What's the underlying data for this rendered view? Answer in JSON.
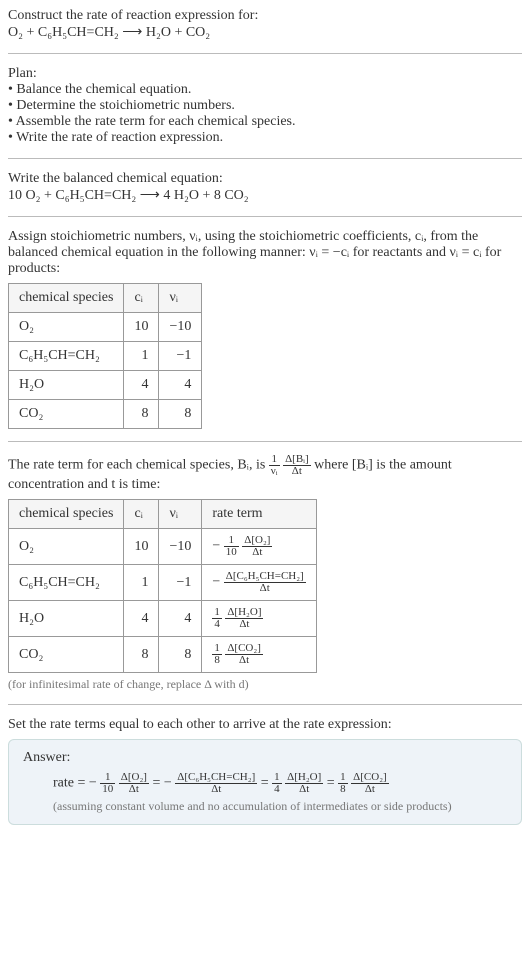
{
  "header": {
    "prompt": "Construct the rate of reaction expression for:",
    "equation": "O₂ + C₆H₅CH=CH₂ ⟶ H₂O + CO₂"
  },
  "plan": {
    "title": "Plan:",
    "items": [
      "• Balance the chemical equation.",
      "• Determine the stoichiometric numbers.",
      "• Assemble the rate term for each chemical species.",
      "• Write the rate of reaction expression."
    ]
  },
  "balanced": {
    "title": "Write the balanced chemical equation:",
    "equation": "10 O₂ + C₆H₅CH=CH₂ ⟶ 4 H₂O + 8 CO₂"
  },
  "stoich": {
    "intro": "Assign stoichiometric numbers, νᵢ, using the stoichiometric coefficients, cᵢ, from the balanced chemical equation in the following manner: νᵢ = −cᵢ for reactants and νᵢ = cᵢ for products:",
    "headers": [
      "chemical species",
      "cᵢ",
      "νᵢ"
    ],
    "rows": [
      {
        "species": "O₂",
        "c": "10",
        "v": "−10"
      },
      {
        "species": "C₆H₅CH=CH₂",
        "c": "1",
        "v": "−1"
      },
      {
        "species": "H₂O",
        "c": "4",
        "v": "4"
      },
      {
        "species": "CO₂",
        "c": "8",
        "v": "8"
      }
    ]
  },
  "rateterm": {
    "intro_pre": "The rate term for each chemical species, Bᵢ, is ",
    "frac1_num": "1",
    "frac1_den": "νᵢ",
    "frac2_num": "Δ[Bᵢ]",
    "frac2_den": "Δt",
    "intro_post": " where [Bᵢ] is the amount concentration and t is time:",
    "headers": [
      "chemical species",
      "cᵢ",
      "νᵢ",
      "rate term"
    ],
    "rows": [
      {
        "species": "O₂",
        "c": "10",
        "v": "−10",
        "sign": "−",
        "coef_num": "1",
        "coef_den": "10",
        "d_num": "Δ[O₂]",
        "d_den": "Δt"
      },
      {
        "species": "C₆H₅CH=CH₂",
        "c": "1",
        "v": "−1",
        "sign": "−",
        "coef_num": "",
        "coef_den": "",
        "d_num": "Δ[C₆H₅CH=CH₂]",
        "d_den": "Δt"
      },
      {
        "species": "H₂O",
        "c": "4",
        "v": "4",
        "sign": "",
        "coef_num": "1",
        "coef_den": "4",
        "d_num": "Δ[H₂O]",
        "d_den": "Δt"
      },
      {
        "species": "CO₂",
        "c": "8",
        "v": "8",
        "sign": "",
        "coef_num": "1",
        "coef_den": "8",
        "d_num": "Δ[CO₂]",
        "d_den": "Δt"
      }
    ],
    "note": "(for infinitesimal rate of change, replace Δ with d)"
  },
  "final": {
    "title": "Set the rate terms equal to each other to arrive at the rate expression:",
    "answer_label": "Answer:",
    "rate_prefix": "rate = ",
    "terms": [
      {
        "sign": "−",
        "coef_num": "1",
        "coef_den": "10",
        "d_num": "Δ[O₂]",
        "d_den": "Δt"
      },
      {
        "sign": "−",
        "coef_num": "",
        "coef_den": "",
        "d_num": "Δ[C₆H₅CH=CH₂]",
        "d_den": "Δt"
      },
      {
        "sign": "",
        "coef_num": "1",
        "coef_den": "4",
        "d_num": "Δ[H₂O]",
        "d_den": "Δt"
      },
      {
        "sign": "",
        "coef_num": "1",
        "coef_den": "8",
        "d_num": "Δ[CO₂]",
        "d_den": "Δt"
      }
    ],
    "eq": " = ",
    "note": "(assuming constant volume and no accumulation of intermediates or side products)"
  }
}
